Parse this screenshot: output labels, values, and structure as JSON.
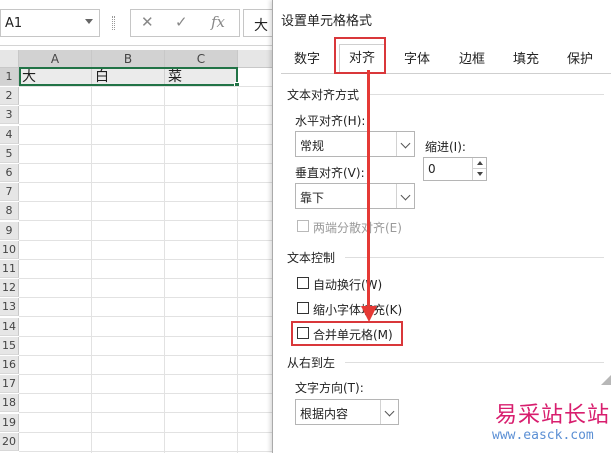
{
  "formula_bar": {
    "name_box": "A1",
    "cancel_icon": "✕",
    "enter_icon": "✓",
    "fx_icon": "fx",
    "content": "大"
  },
  "sheet": {
    "columns": [
      "A",
      "B",
      "C"
    ],
    "rows": [
      "1",
      "2",
      "3",
      "4",
      "5",
      "6",
      "7",
      "8",
      "9",
      "10",
      "11",
      "12",
      "13",
      "14",
      "15",
      "16",
      "17",
      "18",
      "19",
      "20"
    ],
    "cells": {
      "A1": "大",
      "B1": "白",
      "C1": "菜"
    }
  },
  "dialog": {
    "title": "设置单元格格式",
    "tabs": [
      "数字",
      "对齐",
      "字体",
      "边框",
      "填充",
      "保护"
    ],
    "active_tab": "对齐",
    "text_alignment": {
      "title": "文本对齐方式",
      "horizontal_label": "水平对齐(H):",
      "horizontal_value": "常规",
      "vertical_label": "垂直对齐(V):",
      "vertical_value": "靠下",
      "indent_label": "缩进(I):",
      "indent_value": "0",
      "distributed_label": "两端分散对齐(E)"
    },
    "text_control": {
      "title": "文本控制",
      "wrap_text": "自动换行(W)",
      "shrink_to_fit": "缩小字体填充(K)",
      "merge_cells": "合并单元格(M)"
    },
    "rtl": {
      "title": "从右到左",
      "direction_label": "文字方向(T):",
      "direction_value": "根据内容"
    }
  },
  "annotations": {
    "highlight_color": "#d9373a",
    "arrow_color": "#e53935"
  },
  "watermark": {
    "title": "易采站长站",
    "url": "www.easck.com"
  }
}
